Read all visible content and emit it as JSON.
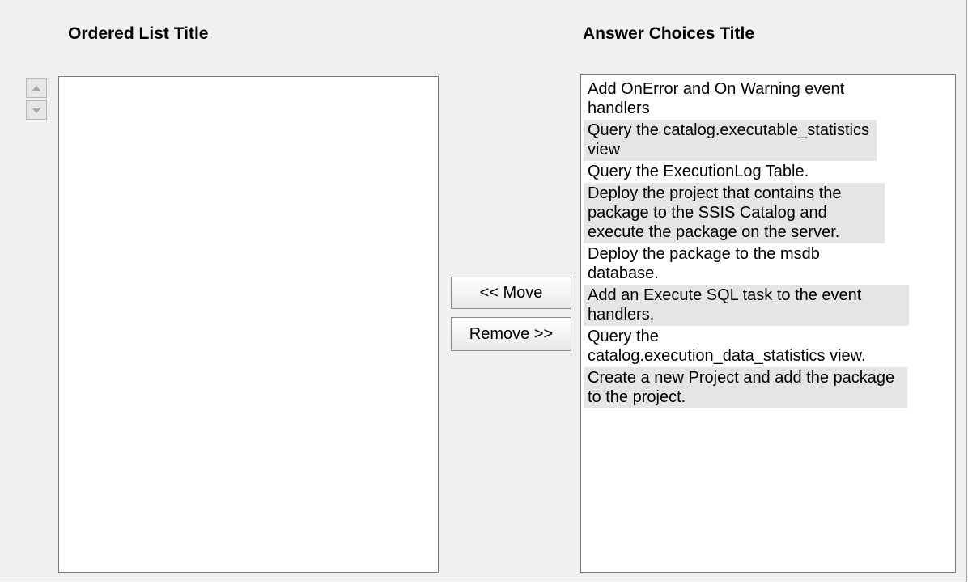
{
  "ordered_list": {
    "title": "Ordered List Title",
    "items": []
  },
  "answer_choices": {
    "title": "Answer Choices Title",
    "items": [
      "Add OnError and On Warning event handlers",
      "Query the catalog.executable_statistics view",
      "Query the ExecutionLog Table.",
      "Deploy the project that contains the package to the SSIS Catalog and execute the package on the server.",
      "Deploy the package to the msdb database.",
      "Add an Execute SQL task to the event handlers.",
      "Query the catalog.execution_data_statistics view.",
      "Create a new Project and add the package to the project."
    ]
  },
  "buttons": {
    "move": "<< Move",
    "remove": "Remove >>"
  },
  "icons": {
    "up": "arrow-up-icon",
    "down": "arrow-down-icon"
  },
  "colors": {
    "background": "#f0f0f0",
    "list_background": "#ffffff",
    "alternate_row": "#e5e5e5",
    "border": "#7a7a7a"
  }
}
